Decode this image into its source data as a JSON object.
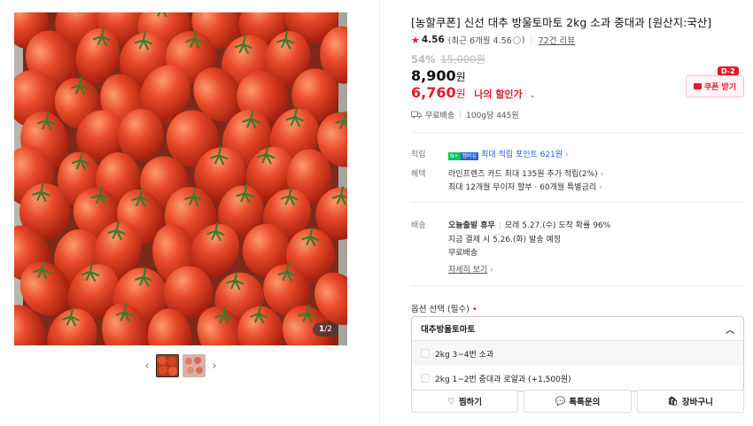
{
  "gallery": {
    "counter_current": "1",
    "counter_total": "/2",
    "prev_arrow": "‹",
    "next_arrow": "›"
  },
  "product": {
    "title": "[농할쿠폰] 신선 대추 방울토마토 2kg 소과 중대과 [원산지:국산]",
    "rating": "4.56",
    "rating_recent": "(최근 6개월 4.56",
    "rating_recent_close": ")",
    "review_count": "72건 리뷰",
    "discount_rate": "54%",
    "original_price": "15,000원",
    "price_value": "8,900",
    "price_unit": "원",
    "coupon_price_value": "6,760",
    "coupon_price_unit": "원",
    "coupon_price_label": "나의 할인가",
    "coupon_button": "쿠폰 받기",
    "coupon_badge": "D-2",
    "shipping_free": "무료배송",
    "unit_price": "100g당 445원"
  },
  "details": {
    "points_label": "적립",
    "points_badge_left": "N+",
    "points_badge_right": "멤버십",
    "points_value": "최대 적립 포인트 621원",
    "benefits_label": "혜택",
    "benefit_1": "라인프렌즈 카드 최대 135원 추가 적립(2%)",
    "benefit_2": "최대 12개월 무이자 할부 · 60개월 특별금리",
    "delivery_label": "배송",
    "delivery_type": "오늘출발 휴무",
    "delivery_arrival": "모레 5.27.(수) 도착 확률 96%",
    "delivery_ship": "지금 결제 시 5.26.(화) 발송 예정",
    "delivery_fee": "무료배송",
    "more_link": "자세히 보기"
  },
  "options": {
    "title": "옵션 선택 (필수)",
    "required_mark": "•",
    "selected": "대추방울토마토",
    "items": [
      "2kg 3~4번 소과",
      "2kg 1~2번 중대과 로얄과 (+1,500원)"
    ]
  },
  "actions": {
    "wishlist": "찜하기",
    "talk": "톡톡문의",
    "cart": "장바구니"
  },
  "colors": {
    "accent_red": "#e5192c",
    "link_blue": "#2b5fd9",
    "naver_green": "#03c75a"
  }
}
